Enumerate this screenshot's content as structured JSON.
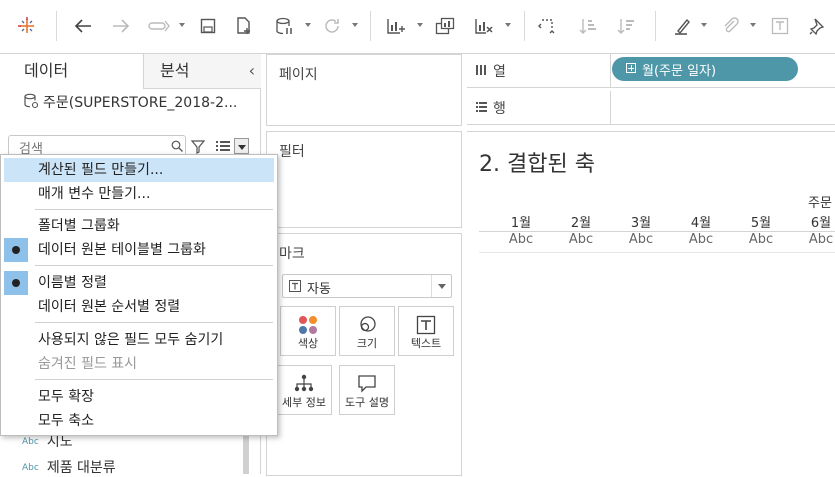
{
  "toolbar": {
    "icons": [
      "tableau-logo-icon",
      "back-icon",
      "forward-icon",
      "replay-icon",
      "save-icon",
      "new-datasource-icon",
      "pause-icon",
      "refresh-icon",
      "new-worksheet-icon",
      "duplicate-icon",
      "clear-icon",
      "swap-icon",
      "sort-asc-icon",
      "sort-desc-icon",
      "highlight-icon",
      "paperclip-icon",
      "label-icon",
      "pin-icon"
    ]
  },
  "left_pane": {
    "tab_data": "데이터",
    "tab_analysis": "분석",
    "collapse": "‹",
    "datasource": "주문(SUPERSTORE_2018-2...",
    "search_placeholder": "검색",
    "fields": [
      {
        "type": "Abc",
        "name": "시도"
      },
      {
        "type": "Abc",
        "name": "제품 대분류"
      }
    ]
  },
  "context_menu": {
    "items": [
      {
        "label": "계산된 필드 만들기...",
        "highlighted": true,
        "checked": false,
        "disabled": false
      },
      {
        "label": "매개 변수 만들기...",
        "highlighted": false,
        "checked": false,
        "disabled": false
      },
      {
        "label": "폴더별 그룹화",
        "highlighted": false,
        "checked": false,
        "disabled": false
      },
      {
        "label": "데이터 원본 테이블별 그룹화",
        "highlighted": false,
        "checked": true,
        "disabled": false
      },
      {
        "label": "이름별 정렬",
        "highlighted": false,
        "checked": true,
        "disabled": false
      },
      {
        "label": "데이터 원본 순서별 정렬",
        "highlighted": false,
        "checked": false,
        "disabled": false
      },
      {
        "label": "사용되지 않은 필드 모두 숨기기",
        "highlighted": false,
        "checked": false,
        "disabled": false
      },
      {
        "label": "숨겨진 필드 표시",
        "highlighted": false,
        "checked": false,
        "disabled": true
      },
      {
        "label": "모두 확장",
        "highlighted": false,
        "checked": false,
        "disabled": false
      },
      {
        "label": "모두 축소",
        "highlighted": false,
        "checked": false,
        "disabled": false
      }
    ]
  },
  "cards": {
    "pages": "페이지",
    "filters": "필터",
    "marks": "마크",
    "mark_type": "자동",
    "mark_buttons": [
      "색상",
      "크기",
      "텍스트",
      "세부 정보",
      "도구 설명"
    ]
  },
  "shelves": {
    "columns_label": "열",
    "rows_label": "행",
    "column_pill": "월(주문 일자)"
  },
  "view": {
    "title": "2. 결합된 축",
    "header_top": "주문",
    "columns": [
      "1월",
      "2월",
      "3월",
      "4월",
      "5월",
      "6월"
    ],
    "cells": [
      "Abc",
      "Abc",
      "Abc",
      "Abc",
      "Abc",
      "Abc"
    ]
  },
  "colors": {
    "pill": "#4e97a8",
    "highlight": "#cce4f7",
    "bullet": "#8ec1ea"
  }
}
